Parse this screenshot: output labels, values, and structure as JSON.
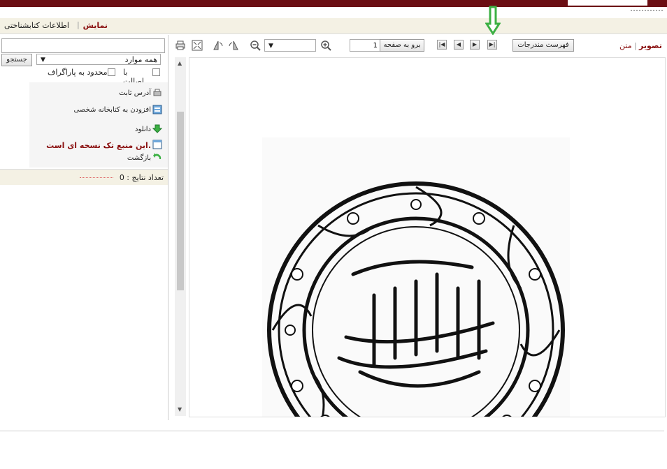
{
  "tabs": {
    "display": "نمایش",
    "bibliographic": "اطلاعات کتابشناختی"
  },
  "search": {
    "placeholder": "",
    "scope": "همه موارد",
    "button": "جستجو",
    "authentic": "با اصالت",
    "paragraph": "محدود به پاراگراف"
  },
  "actions": {
    "permalink": "آدرس ثابت",
    "add_library": "افزودن به کتابخانه شخصی",
    "download": "دانلود",
    "single_copy": "این منبع تک نسخه ای است.",
    "back": "بازگشت"
  },
  "results": {
    "label": "تعداد نتایج : 0"
  },
  "viewer": {
    "mode_image": "تصویر",
    "mode_text": "متن",
    "toc_button": "فهرست مندرجات",
    "goto_button": "برو به صفحه",
    "page_number": "1",
    "zoom_value": ""
  },
  "colors": {
    "brand": "#6b0f14",
    "accent_text": "#8a1010",
    "arrow": "#3cb043"
  },
  "icons": [
    "print-icon",
    "fullscreen-icon",
    "rotate-left-icon",
    "rotate-right-icon",
    "zoom-out-icon",
    "zoom-in-icon",
    "first-page-icon",
    "prev-page-icon",
    "next-page-icon",
    "last-page-icon"
  ]
}
